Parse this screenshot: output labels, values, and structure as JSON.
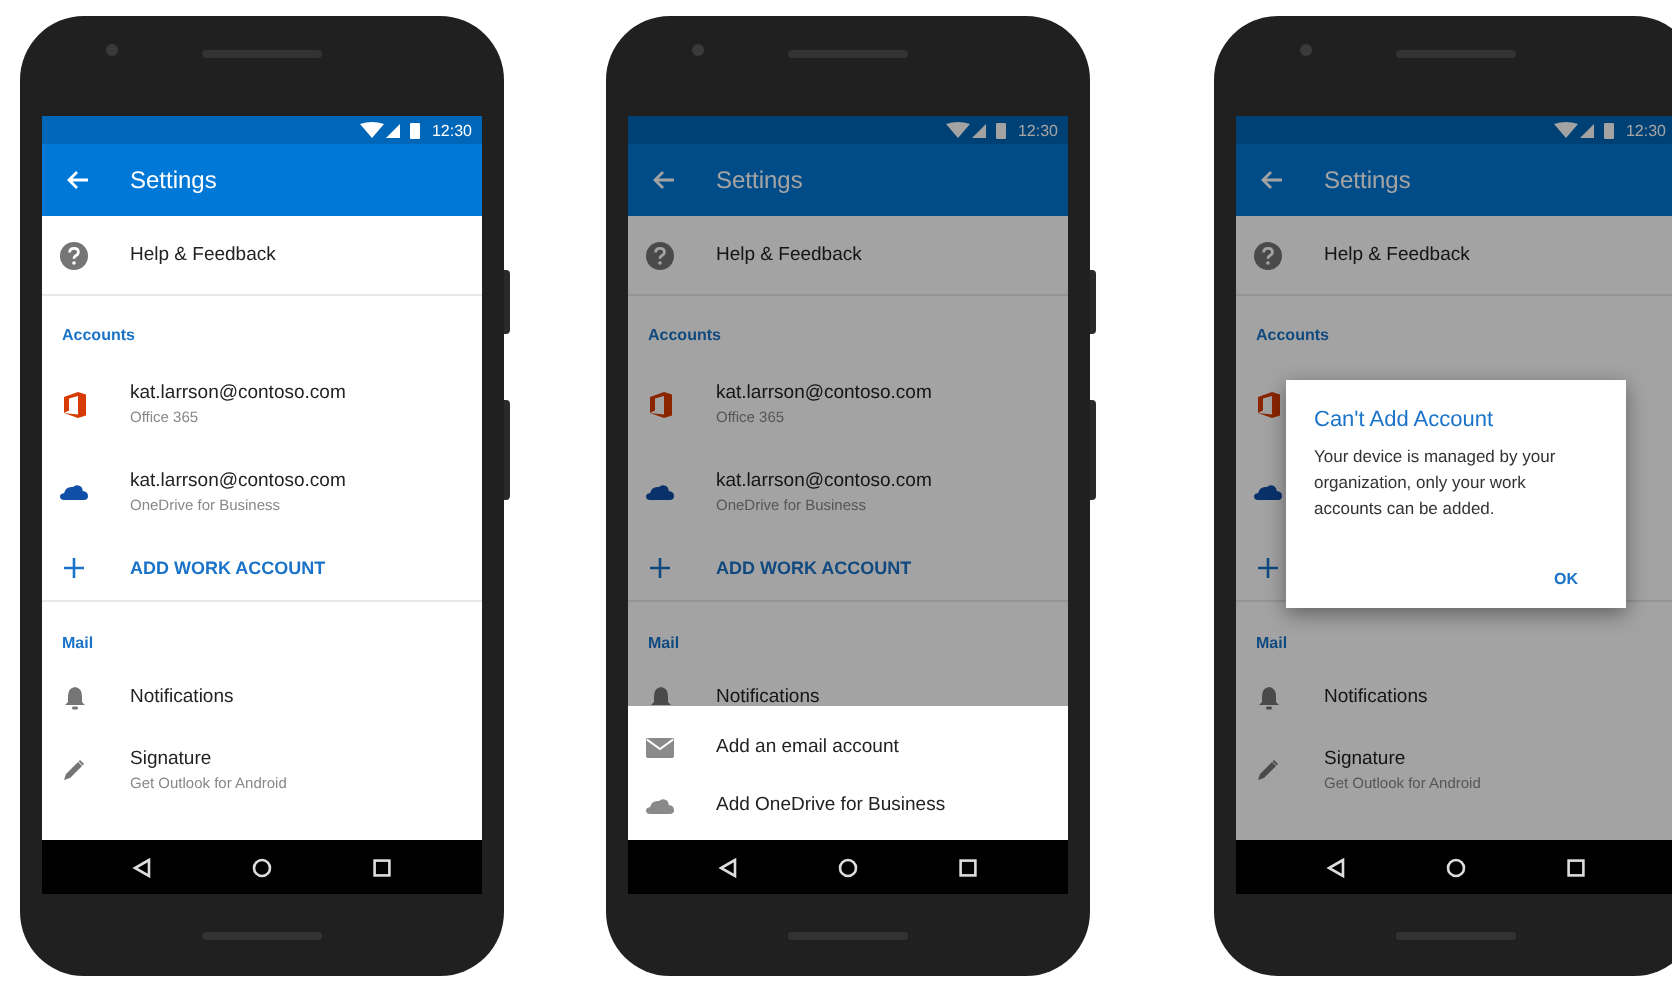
{
  "phones": [
    {
      "status_time": "12:30",
      "title": "Settings",
      "dimmed": false,
      "rows": [
        {
          "kind": "help",
          "title": "Help & Feedback"
        },
        {
          "kind": "header",
          "title": "Accounts"
        },
        {
          "kind": "office",
          "title": "kat.larrson@contoso.com",
          "subtitle": "Office 365"
        },
        {
          "kind": "onedrive",
          "title": "kat.larrson@contoso.com",
          "subtitle": "OneDrive for Business"
        },
        {
          "kind": "add",
          "title": "ADD WORK ACCOUNT"
        },
        {
          "kind": "header",
          "title": "Mail"
        },
        {
          "kind": "bell",
          "title": "Notifications"
        },
        {
          "kind": "pen",
          "title": "Signature",
          "subtitle": "Get Outlook for Android"
        }
      ]
    },
    {
      "status_time": "12:30",
      "title": "Settings",
      "dimmed": true,
      "rows": [
        {
          "kind": "help",
          "title": "Help & Feedback"
        },
        {
          "kind": "header",
          "title": "Accounts"
        },
        {
          "kind": "office",
          "title": "kat.larrson@contoso.com",
          "subtitle": "Office 365"
        },
        {
          "kind": "onedrive",
          "title": "kat.larrson@contoso.com",
          "subtitle": "OneDrive for Business"
        },
        {
          "kind": "add",
          "title": "ADD WORK ACCOUNT"
        },
        {
          "kind": "header",
          "title": "Mail"
        },
        {
          "kind": "bell",
          "title": "Notifications"
        }
      ],
      "sheet": [
        {
          "kind": "mail",
          "label": "Add an email account"
        },
        {
          "kind": "cloud",
          "label": "Add OneDrive for Business"
        }
      ]
    },
    {
      "status_time": "12:30",
      "title": "Settings",
      "dimmed": true,
      "rows": [
        {
          "kind": "help",
          "title": "Help & Feedback"
        },
        {
          "kind": "header",
          "title": "Accounts"
        },
        {
          "kind": "office"
        },
        {
          "kind": "onedrive"
        },
        {
          "kind": "add"
        },
        {
          "kind": "header",
          "title": "Mail"
        },
        {
          "kind": "bell",
          "title": "Notifications"
        },
        {
          "kind": "pen",
          "title": "Signature",
          "subtitle": "Get Outlook for Android"
        }
      ],
      "dialog": {
        "title": "Can't Add Account",
        "message": "Your device is managed by your organization, only your work accounts can be added.",
        "button": "OK"
      }
    }
  ]
}
